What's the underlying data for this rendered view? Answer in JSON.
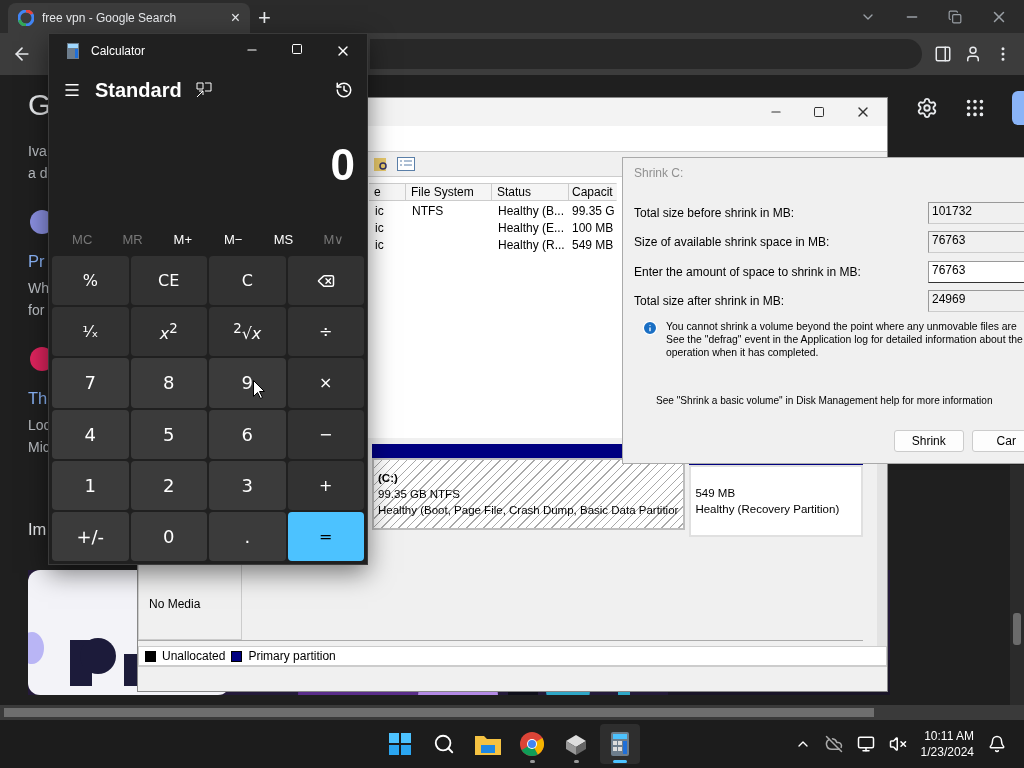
{
  "browser": {
    "tab": {
      "title": "free vpn - Google Search",
      "close": "×",
      "selected": true
    },
    "new_tab": "+",
    "page": {
      "logo": "G",
      "results": [
        {
          "kind": "text",
          "snippet": [
            "Iva",
            "a d"
          ]
        },
        {
          "kind": "site",
          "color": "#8a8fe0",
          "title": "Pr",
          "snippet": [
            "Wh",
            "for"
          ]
        },
        {
          "kind": "site",
          "color": "#e0245e",
          "title": "Th",
          "snippet": [
            "Loc",
            "Mic"
          ]
        }
      ],
      "section_heading": "Im"
    }
  },
  "disk_management": {
    "columns": [
      "e",
      "File System",
      "Status",
      "Capacit"
    ],
    "rows": [
      {
        "column_1": "ic",
        "file_system": "NTFS",
        "status": "Healthy (B...",
        "capacity": "99.35 G"
      },
      {
        "column_1": "ic",
        "status": "Healthy (E...",
        "capacity": "100 MB"
      },
      {
        "column_1": "ic",
        "status": "Healthy (R...",
        "capacity": "549 MB"
      }
    ],
    "partitions": [
      {
        "name": "(C:)",
        "size": "99.35 GB NTFS",
        "status": "Healthy (Boot, Page File, Crash Dump, Basic Data Partitior",
        "selected": true
      },
      {
        "size": "549 MB",
        "status": "Healthy (Recovery Partition)",
        "selected": false
      }
    ],
    "cdrom": {
      "status": "No Media"
    },
    "legend": [
      {
        "label": "Unallocated",
        "color": "#000000"
      },
      {
        "label": "Primary partition",
        "color": "#000080"
      }
    ]
  },
  "shrink_dialog": {
    "title": "Shrink C:",
    "fields": [
      {
        "label": "Total size before shrink in MB:",
        "value": "101732",
        "editable": false
      },
      {
        "label": "Size of available shrink space in MB:",
        "value": "76763",
        "editable": false
      },
      {
        "label": "Enter the amount of space to shrink in MB:",
        "value": "76763",
        "editable": true
      },
      {
        "label": "Total size after shrink in MB:",
        "value": "24969",
        "editable": false
      }
    ],
    "info": [
      "You cannot shrink a volume beyond the point where any unmovable files are",
      "See the \"defrag\" event in the Application log for detailed information about the",
      "operation when it has completed."
    ],
    "help": "See \"Shrink a basic volume\" in Disk Management help for more information",
    "buttons": [
      "Shrink",
      "Car"
    ]
  },
  "calculator": {
    "title": "Calculator",
    "mode": "Standard",
    "display": "0",
    "memory": [
      {
        "label": "MC",
        "disabled": true
      },
      {
        "label": "MR",
        "disabled": true
      },
      {
        "label": "M+",
        "disabled": false
      },
      {
        "label": "M−",
        "disabled": false
      },
      {
        "label": "MS",
        "disabled": false
      },
      {
        "label": "M∨",
        "disabled": true
      }
    ],
    "keys": [
      {
        "label": "%",
        "kind": "op"
      },
      {
        "label": "CE",
        "kind": "op"
      },
      {
        "label": "C",
        "kind": "op"
      },
      {
        "kind": "backspace"
      },
      {
        "label": "¹⁄ₓ",
        "kind": "op"
      },
      {
        "label": "*x*$^{2}$",
        "kind": "op"
      },
      {
        "label": "$^{2}$√*x*",
        "kind": "op"
      },
      {
        "label": "÷",
        "kind": "op"
      },
      {
        "label": "7",
        "kind": "digit"
      },
      {
        "label": "8",
        "kind": "digit"
      },
      {
        "label": "9",
        "kind": "digit"
      },
      {
        "label": "×",
        "kind": "op"
      },
      {
        "label": "4",
        "kind": "digit"
      },
      {
        "label": "5",
        "kind": "digit"
      },
      {
        "label": "6",
        "kind": "digit"
      },
      {
        "label": "−",
        "kind": "op"
      },
      {
        "label": "1",
        "kind": "digit"
      },
      {
        "label": "2",
        "kind": "digit"
      },
      {
        "label": "3",
        "kind": "digit"
      },
      {
        "label": "+",
        "kind": "op"
      },
      {
        "label": "+/-",
        "kind": "digit"
      },
      {
        "label": "0",
        "kind": "digit"
      },
      {
        "label": ".",
        "kind": "digit"
      },
      {
        "label": "=",
        "kind": "equals"
      }
    ]
  },
  "taskbar": {
    "apps": [
      {
        "kind": "start",
        "running": false,
        "selected": false
      },
      {
        "kind": "search",
        "running": false,
        "selected": false
      },
      {
        "kind": "explorer",
        "running": false,
        "selected": false
      },
      {
        "kind": "chrome",
        "running": true,
        "selected": false
      },
      {
        "kind": "app",
        "running": true,
        "selected": false
      },
      {
        "kind": "calculator",
        "running": true,
        "selected": true
      }
    ],
    "time": "10:11 AM",
    "date": "1/23/2024"
  }
}
